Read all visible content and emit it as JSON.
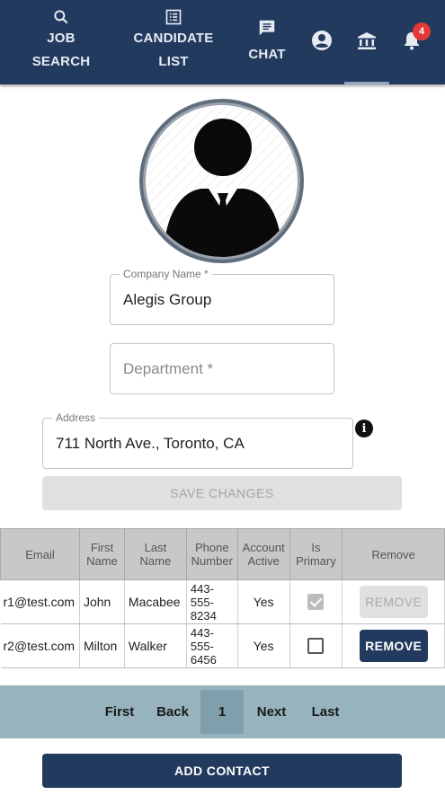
{
  "nav": {
    "job_search_line1": "JOB",
    "job_search_line2": "SEARCH",
    "candidate_list_line1": "CANDIDATE",
    "candidate_list_line2": "LIST",
    "chat": "CHAT",
    "notification_count": "4"
  },
  "form": {
    "company_name_label": "Company Name *",
    "company_name_value": "Alegis Group",
    "department_placeholder": "Department *",
    "address_label": "Address",
    "address_value": "711 North Ave., Toronto, CA",
    "info_glyph": "i",
    "save_button": "SAVE CHANGES"
  },
  "table": {
    "headers": {
      "email": "Email",
      "first_name_1": "First",
      "first_name_2": "Name",
      "last_name_1": "Last",
      "last_name_2": "Name",
      "phone_1": "Phone",
      "phone_2": "Number",
      "active_1": "Account",
      "active_2": "Active",
      "primary_1": "Is",
      "primary_2": "Primary",
      "remove": "Remove"
    },
    "rows": [
      {
        "email": "r1@test.com",
        "first": "John",
        "last": "Macabee",
        "phone_1": "443-",
        "phone_2": "555-",
        "phone_3": "8234",
        "active": "Yes",
        "is_primary": true,
        "remove": "REMOVE"
      },
      {
        "email": "r2@test.com",
        "first": "Milton",
        "last": "Walker",
        "phone_1": "443-",
        "phone_2": "555-",
        "phone_3": "6456",
        "active": "Yes",
        "is_primary": false,
        "remove": "REMOVE"
      }
    ]
  },
  "pager": {
    "first": "First",
    "back": "Back",
    "current": "1",
    "next": "Next",
    "last": "Last"
  },
  "add_contact": "ADD CONTACT",
  "colors": {
    "navy": "#223a5e",
    "pager_bg": "#97b3be",
    "badge": "#e53935"
  }
}
